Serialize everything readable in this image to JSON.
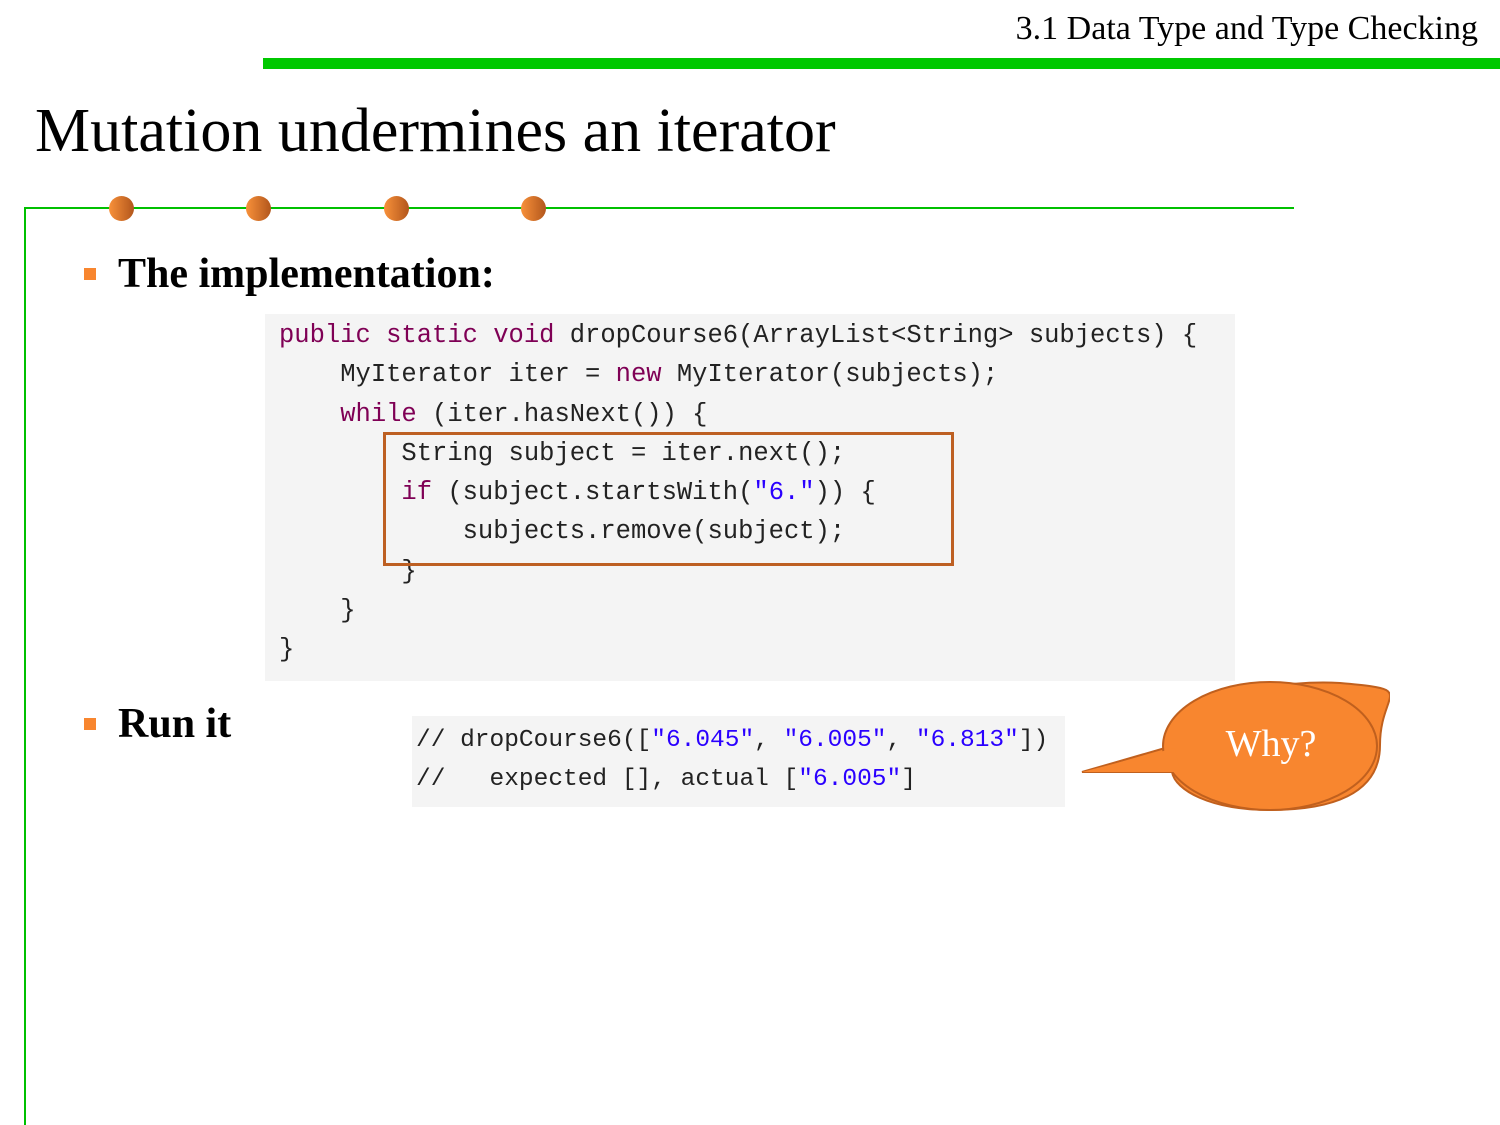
{
  "header": {
    "section": "3.1 Data Type and Type Checking"
  },
  "slide": {
    "title": "Mutation undermines an iterator"
  },
  "bullets": [
    {
      "label": "The implementation:"
    },
    {
      "label": "Run it"
    }
  ],
  "colors": {
    "accent_green": "#00c800",
    "bullet_orange": "#f8862f",
    "highlight_border": "#bd5f22",
    "keyword": "#7f0055",
    "string": "#2a00ff"
  },
  "code_impl": [
    [
      [
        "kw",
        "public static void "
      ],
      [
        "pl",
        "dropCourse6(ArrayList<String> subjects) {"
      ]
    ],
    [
      [
        "pl",
        "    MyIterator iter = "
      ],
      [
        "kw",
        "new "
      ],
      [
        "pl",
        "MyIterator(subjects);"
      ]
    ],
    [
      [
        "kw",
        "    while "
      ],
      [
        "pl",
        "(iter.hasNext()) {"
      ]
    ],
    [
      [
        "pl",
        "        String subject = iter.next();"
      ]
    ],
    [
      [
        "kw",
        "        if "
      ],
      [
        "pl",
        "(subject.startsWith("
      ],
      [
        "str",
        "\"6.\""
      ],
      [
        "pl",
        ")) {"
      ]
    ],
    [
      [
        "pl",
        "            subjects.remove(subject);"
      ]
    ],
    [
      [
        "pl",
        "        }"
      ]
    ],
    [
      [
        "pl",
        "    }"
      ]
    ],
    [
      [
        "pl",
        "}"
      ]
    ]
  ],
  "code_run": [
    [
      [
        "pl",
        "// dropCourse6(["
      ],
      [
        "str",
        "\"6.045\""
      ],
      [
        "pl",
        ", "
      ],
      [
        "str",
        "\"6.005\""
      ],
      [
        "pl",
        ", "
      ],
      [
        "str",
        "\"6.813\""
      ],
      [
        "pl",
        "])"
      ]
    ],
    [
      [
        "pl",
        "//   expected [], actual ["
      ],
      [
        "str",
        "\"6.005\""
      ],
      [
        "pl",
        "]"
      ]
    ]
  ],
  "callout": {
    "text": "Why?",
    "fill": "#f8862f",
    "stroke": "#c0601e"
  }
}
